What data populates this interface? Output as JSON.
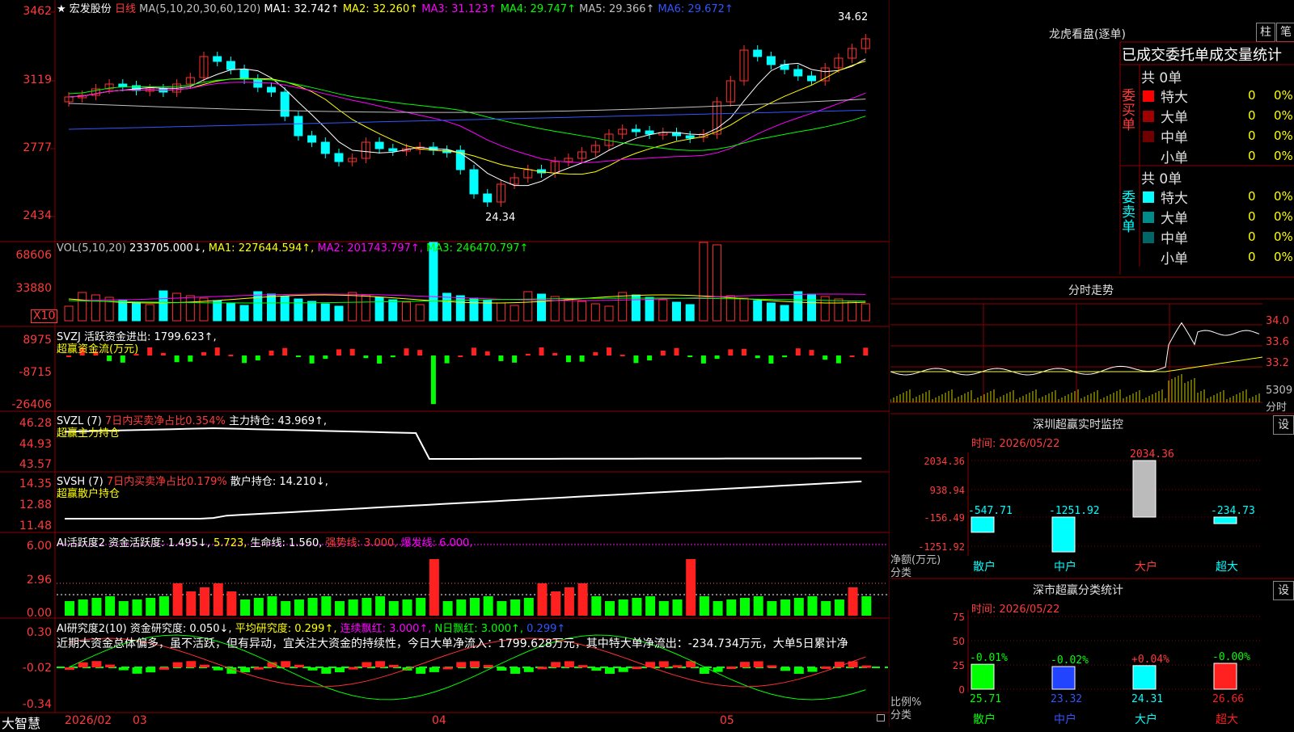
{
  "header": {
    "star": "★",
    "stock_name": "宏发股份",
    "period": "日线",
    "ma_params": "MA(5,10,20,30,60,120)",
    "ma_items": [
      {
        "label": "MA1: 32.742↑",
        "color": "#ffffff"
      },
      {
        "label": "MA2: 32.260↑",
        "color": "#ffff00"
      },
      {
        "label": "MA3: 31.123↑",
        "color": "#ff00ff"
      },
      {
        "label": "MA4: 29.747↑",
        "color": "#00ff00"
      },
      {
        "label": "MA5: 29.366↑",
        "color": "#c0c0c0"
      },
      {
        "label": "MA6: 29.672↑",
        "color": "#3355ff"
      }
    ],
    "price_high_marker": "34.62",
    "price_low_marker": "24.34"
  },
  "price_axis": [
    "3462",
    "3119",
    "2777",
    "2434"
  ],
  "vol": {
    "header": "VOL(5,10,20)",
    "value": "233705.000↓,",
    "ma": [
      {
        "label": "MA1: 227644.594↑,",
        "color": "#ffff00"
      },
      {
        "label": "MA2: 201743.797↑,",
        "color": "#ff00ff"
      },
      {
        "label": "MA3: 246470.797↑",
        "color": "#00ff00"
      }
    ],
    "axis": [
      "68606",
      "33880"
    ],
    "unit": "X10"
  },
  "svzj": {
    "header": "SVZJ  活跃资金进出: 1799.623↑,",
    "sub": "超赢资金流(万元)",
    "axis": [
      "8975",
      "-8715",
      "-26406"
    ]
  },
  "svzl": {
    "header_a": "SVZL (7)",
    "header_b": "7日内买卖净占比0.354%",
    "header_c": "主力持仓: 43.969↑,",
    "sub": "超赢主力持仓",
    "axis": [
      "46.28",
      "44.93",
      "43.57"
    ]
  },
  "svsh": {
    "header_a": "SVSH (7)",
    "header_b": "7日内买卖净占比0.179%",
    "header_c": "散户持仓: 14.210↓,",
    "sub": "超赢散户持仓",
    "axis": [
      "14.35",
      "12.88",
      "11.48"
    ]
  },
  "ai1": {
    "header_a": "AI活跃度2 资金活跃度: 1.495↓,",
    "header_b": "5.723,",
    "header_c": "生命线: 1.560,",
    "header_d": "强势线: 3.000,",
    "header_e": "爆发线: 6.000,",
    "axis": [
      "6.00",
      "2.96",
      "0.00"
    ]
  },
  "ai2": {
    "header_a": "AI研究度2(10) 资金研究度: 0.050↓,",
    "header_b": "平均研究度: 0.299↑,",
    "header_c": "连续飘红: 3.000↑,",
    "header_d": "N日飘红: 3.000↑,",
    "header_e": "0.299↑",
    "comment": "近期大资金总体偏多，虽不活跃，但有异动，宜关注大资金的持续性，今日大单净流入：1799.628万元，其中特大单净流出：-234.734万元，大单5日累计净",
    "axis": [
      "0.30",
      "-0.02",
      "-0.34"
    ]
  },
  "time_axis": [
    "2026/02",
    "03",
    "04",
    "05"
  ],
  "brand": "大智慧",
  "side": {
    "lhkp_title": "龙虎看盘(逐单)",
    "btn_bar": "柱",
    "btn_pen": "笔",
    "tabs": "已成交委托单成交量统计",
    "buy_label": "委买单",
    "sell_label": "委卖单",
    "buy_total": "共 0单",
    "sell_total": "共 0单",
    "buy_rows": [
      {
        "name": "特大",
        "count": "0",
        "pct": "0%",
        "color": "#ff0000"
      },
      {
        "name": "大单",
        "count": "0",
        "pct": "0%",
        "color": "#a00000"
      },
      {
        "name": "中单",
        "count": "0",
        "pct": "0%",
        "color": "#700000"
      },
      {
        "name": "小单",
        "count": "0",
        "pct": "0%",
        "color": "#000000"
      }
    ],
    "sell_rows": [
      {
        "name": "特大",
        "count": "0",
        "pct": "0%",
        "color": "#00ffff"
      },
      {
        "name": "大单",
        "count": "0",
        "pct": "0%",
        "color": "#008b8b"
      },
      {
        "name": "中单",
        "count": "0",
        "pct": "0%",
        "color": "#006666"
      },
      {
        "name": "小单",
        "count": "0",
        "pct": "0%",
        "color": "#000000"
      }
    ],
    "fs_title": "分时走势",
    "fs_axis": [
      "34.0",
      "33.6",
      "33.2"
    ],
    "fs_vol": "5309",
    "fs_unit": "分时",
    "sz_title": "深圳超赢实时监控",
    "sz_btn": "设",
    "sz_time": "时间: 2026/05/22",
    "sz_axis": [
      "2034.36",
      "938.94",
      "-156.49",
      "-1251.92"
    ],
    "sz_ylabel": "净额(万元)",
    "sz_xlabel": "分类",
    "sz_bars": [
      {
        "name": "散户",
        "value": "-547.71"
      },
      {
        "name": "中户",
        "value": "-1251.92"
      },
      {
        "name": "大户",
        "value": "2034.36"
      },
      {
        "name": "超大",
        "value": "-234.73"
      }
    ],
    "sc_title": "深市超赢分类统计",
    "sc_btn": "设",
    "sc_time": "时间: 2026/05/22",
    "sc_axis": [
      "75",
      "50",
      "25",
      "0"
    ],
    "sc_ylabel": "比例%",
    "sc_xlabel": "分类",
    "sc_bars": [
      {
        "name": "散户",
        "value": "25.71",
        "delta": "-0.01%"
      },
      {
        "name": "中户",
        "value": "23.32",
        "delta": "-0.02%"
      },
      {
        "name": "大户",
        "value": "24.31",
        "delta": "+0.04%"
      },
      {
        "name": "超大",
        "value": "26.66",
        "delta": "-0.00%"
      }
    ]
  }
}
